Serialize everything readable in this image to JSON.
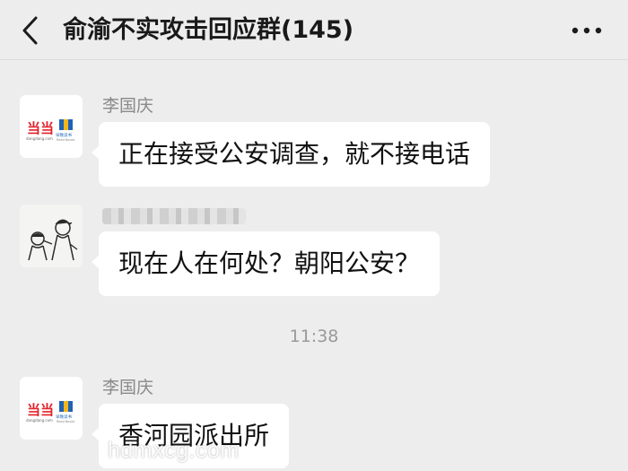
{
  "header": {
    "title": "俞渝不实攻击回应群(145)",
    "back_icon": "chevron-left-icon",
    "more_icon": "more-dots-icon"
  },
  "messages": [
    {
      "sender": "李国庆",
      "avatar": "dangdang-logo-avatar",
      "avatar_texts": [
        "当当",
        "dangdang.com",
        "早晚读书",
        "Read Books"
      ],
      "text": "正在接受公安调查，就不接电话"
    },
    {
      "sender": "",
      "sender_obscured": true,
      "avatar": "sketch-figures-avatar",
      "text": "现在人在何处？朝阳公安？"
    },
    {
      "sender": "李国庆",
      "avatar": "dangdang-logo-avatar",
      "avatar_texts": [
        "当当",
        "dangdang.com",
        "早晚读书",
        "Read Books"
      ],
      "text": "香河园派出所"
    }
  ],
  "timestamp": "11:38",
  "watermark": "hdmxcg.com",
  "colors": {
    "background": "#ededed",
    "bubble": "#ffffff",
    "brand_red": "#e1232b",
    "brand_blue": "#1f63b5",
    "brand_yellow": "#f2b51c"
  }
}
